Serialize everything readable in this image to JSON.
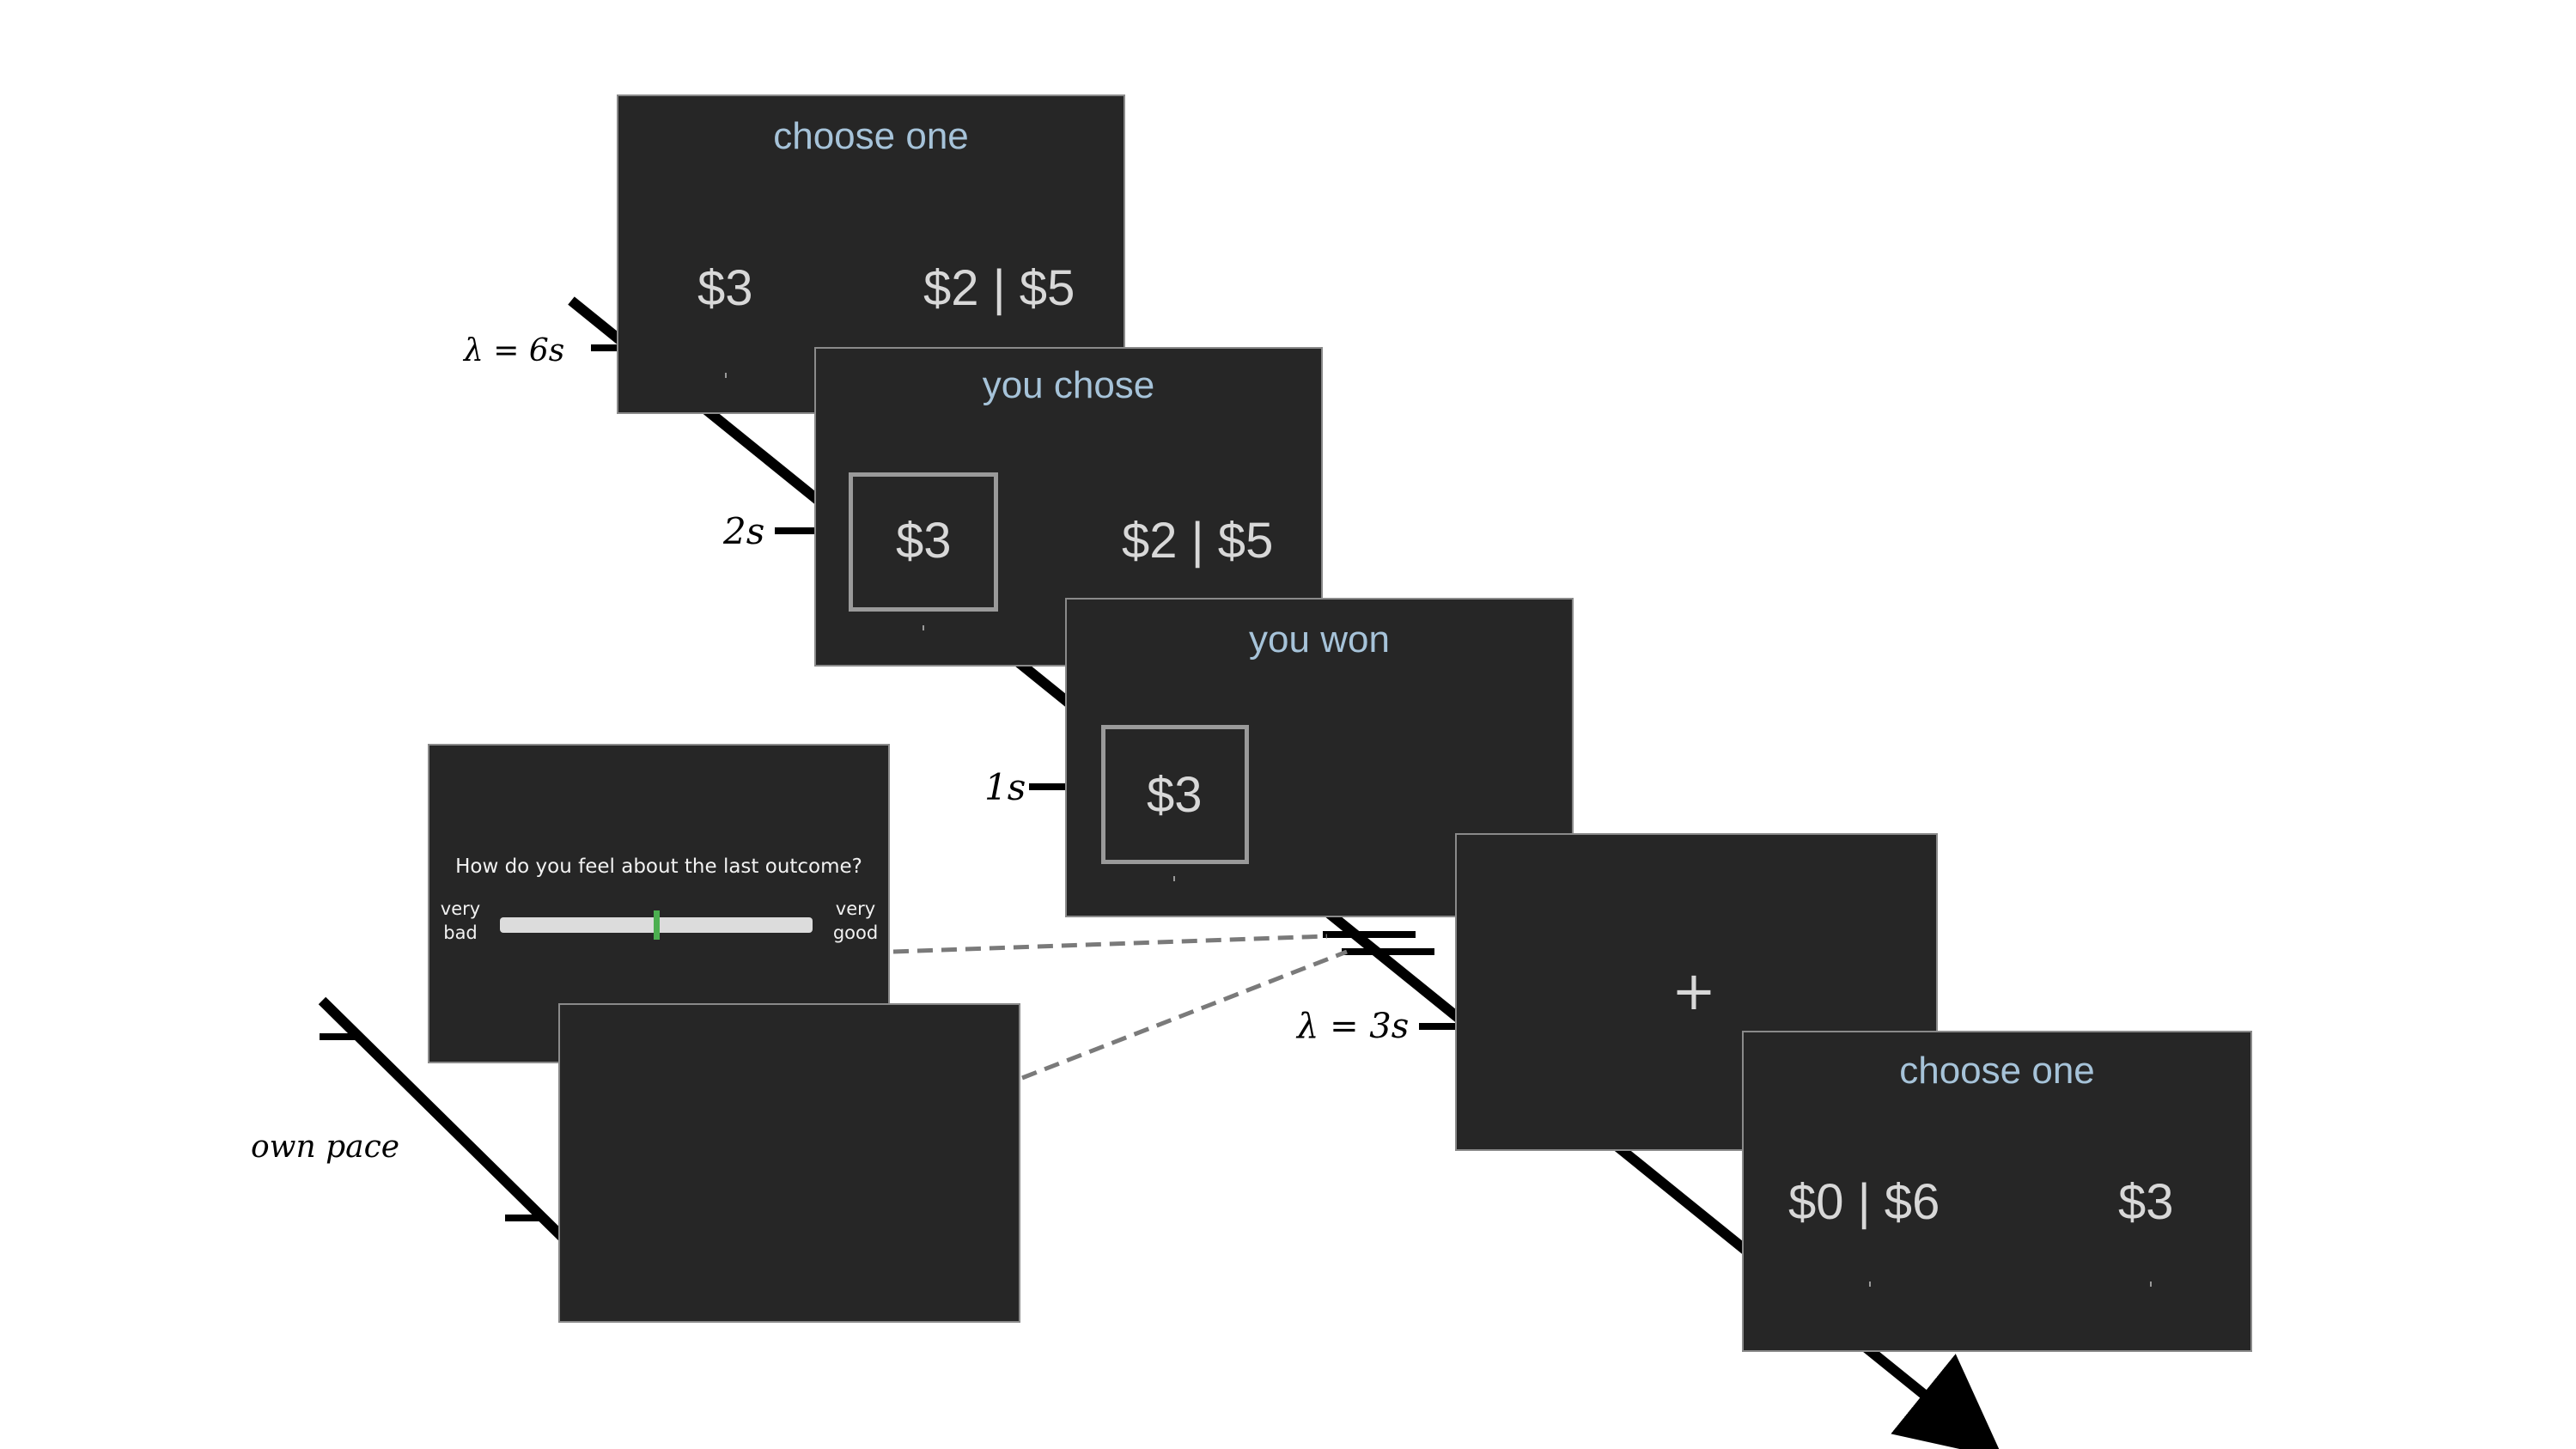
{
  "timing": {
    "lambda6": "λ = 6s",
    "two": "2s",
    "one": "1s",
    "lambda3": "λ = 3s",
    "own_pace": "own pace"
  },
  "screens": {
    "choice1": {
      "header": "choose one",
      "left": "$3",
      "right": "$2 | $5"
    },
    "chose": {
      "header": "you chose",
      "left": "$3",
      "right": "$2 | $5"
    },
    "won": {
      "header": "you won",
      "value": "$3"
    },
    "fixation": {
      "symbol": "+"
    },
    "choice2": {
      "header": "choose one",
      "left": "$0 | $6",
      "right": "$3"
    },
    "rating": {
      "question": "How do you feel about the last outcome?",
      "low": "very bad",
      "high": "very good",
      "slider_value": 0.5,
      "slider_color": "#4caf50"
    }
  },
  "colors": {
    "screen_bg": "#262626",
    "header_text": "#a6c3d9",
    "option_text": "#d8d8d8"
  }
}
